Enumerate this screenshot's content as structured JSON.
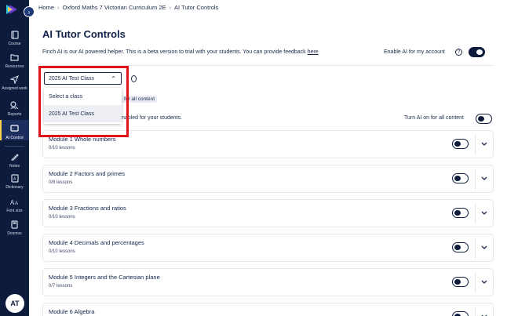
{
  "sidebar": {
    "items": [
      {
        "label": "Course",
        "icon": "course-icon"
      },
      {
        "label": "Resources",
        "icon": "folder-icon"
      },
      {
        "label": "Assigned work",
        "icon": "paper-plane-icon"
      },
      {
        "label": "Reports",
        "icon": "reports-icon"
      },
      {
        "label": "AI Control",
        "icon": "ai-control-icon",
        "active": true
      },
      {
        "label": "Notes",
        "icon": "pencil-icon"
      },
      {
        "label": "Dictionary",
        "icon": "dictionary-icon"
      },
      {
        "label": "Font size",
        "icon": "font-size-icon"
      },
      {
        "label": "Desmos",
        "icon": "calculator-icon"
      }
    ],
    "avatar": "AT",
    "accent": "#ffd24a",
    "background": "#0d1b3d"
  },
  "breadcrumb": [
    "Home",
    "Oxford Maths 7 Victorian Curriculum 2E",
    "AI Tutor Controls"
  ],
  "page": {
    "title": "AI Tutor Controls",
    "description": "Finch AI is our AI powered helper. This is a beta version to trial with your students. You can provide feedback ",
    "feedback_link": "here",
    "enable_label": "Enable AI for my account",
    "enable_on": true
  },
  "class_select": {
    "selected": "2025 AI Test Class",
    "options": [
      "Select a class",
      "2025 AI Test Class"
    ],
    "tag_text": "for all content",
    "partial_text": "nabled for your students.",
    "turn_all_label": "Turn AI on for all content",
    "turn_all_on": false
  },
  "modules": [
    {
      "title": "Module 1 Whole numbers",
      "lessons": "0/10 lessons"
    },
    {
      "title": "Module 2 Factors and primes",
      "lessons": "0/8 lessons"
    },
    {
      "title": "Module 3 Fractions and ratios",
      "lessons": "0/10 lessons"
    },
    {
      "title": "Module 4 Decimals and percentages",
      "lessons": "0/10 lessons"
    },
    {
      "title": "Module 5 Integers and the Cartesian plane",
      "lessons": "0/7 lessons"
    },
    {
      "title": "Module 6 Algebra",
      "lessons": ""
    }
  ],
  "colors": {
    "highlight_box": "#e01418",
    "navy": "#0d1b3d"
  }
}
